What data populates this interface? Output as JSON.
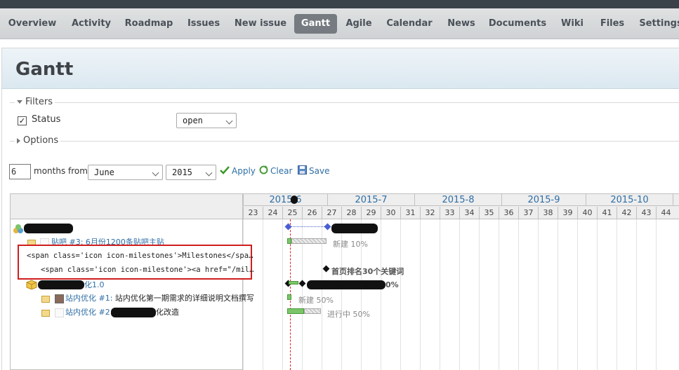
{
  "menu": {
    "items": [
      "Overview",
      "Activity",
      "Roadmap",
      "Issues",
      "New issue",
      "Gantt",
      "Agile",
      "Calendar",
      "News",
      "Documents",
      "Wiki",
      "Files",
      "Settings"
    ],
    "active": "Gantt"
  },
  "page": {
    "title": "Gantt"
  },
  "filters": {
    "legend": "Filters",
    "status_label": "Status",
    "status_checked": true,
    "status_operator": "open"
  },
  "options": {
    "legend": "Options"
  },
  "query": {
    "months_value": "6",
    "months_from_label": "months from",
    "month_value": "June",
    "year_value": "2015",
    "apply_label": "Apply",
    "clear_label": "Clear",
    "save_label": "Save"
  },
  "gantt": {
    "months": [
      "2015-6",
      "2015-7",
      "2015-8",
      "2015-9",
      "2015-10"
    ],
    "weeks": [
      "23",
      "24",
      "25",
      "26",
      "27",
      "28",
      "29",
      "30",
      "31",
      "32",
      "33",
      "34",
      "35",
      "36",
      "37",
      "38",
      "39",
      "40",
      "41",
      "42",
      "43",
      "44"
    ],
    "rows": {
      "r2_text": "贴吧 #3: 6月份1200条贴吧主贴",
      "r3_code": "<span class='icon icon-milestones'>Milestones</spa…",
      "r4_code": "<span class='icon icon-milestone'><a href=\"/mil…",
      "r5_suffix": "化1.0",
      "r6_link": "站内优化 #1:",
      "r6_text": "站内优化第一期需求的详细说明文档撰写",
      "r7_link": "站内优化 #2:",
      "r7_suffix": "化改造"
    },
    "bar_labels": {
      "r2": "新建 10%",
      "r4": "首页排名30个关键词",
      "r5": "0%",
      "r6": "新建 50%",
      "r7": "进行中 50%"
    }
  },
  "colors": {
    "accent": "#2e6ea4",
    "active_tab": "#757b80",
    "today_line": "#dd2222",
    "highlight_box": "#d01d1d"
  }
}
